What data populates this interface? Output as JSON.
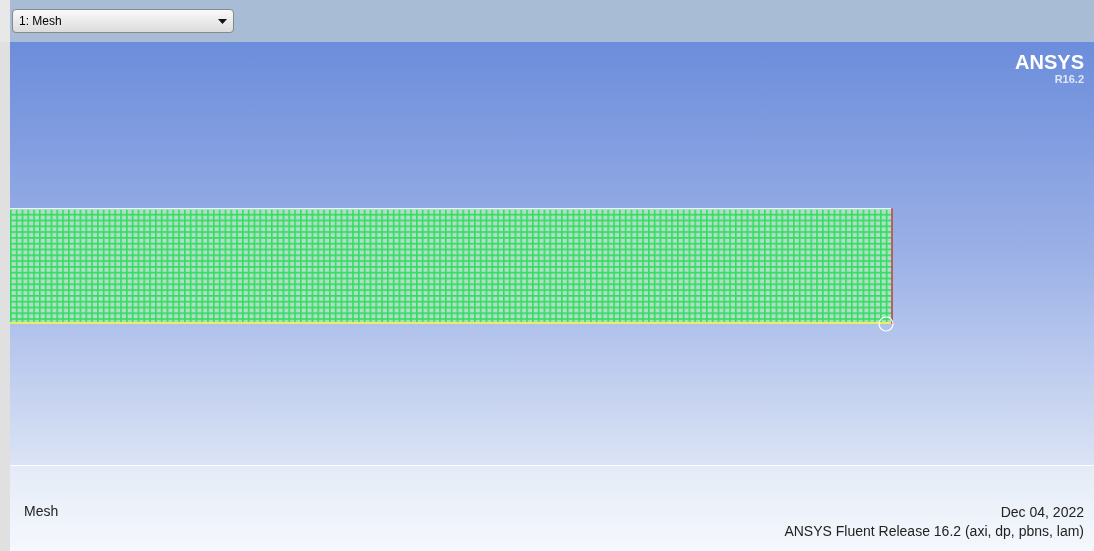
{
  "toolbar": {
    "view_dropdown": {
      "value": "1: Mesh"
    }
  },
  "logo": {
    "name": "ANSYS",
    "version": "R16.2"
  },
  "footer": {
    "title": "Mesh",
    "date": "Dec 04, 2022",
    "release": "ANSYS Fluent Release 16.2 (axi, dp, pbns, lam)"
  }
}
